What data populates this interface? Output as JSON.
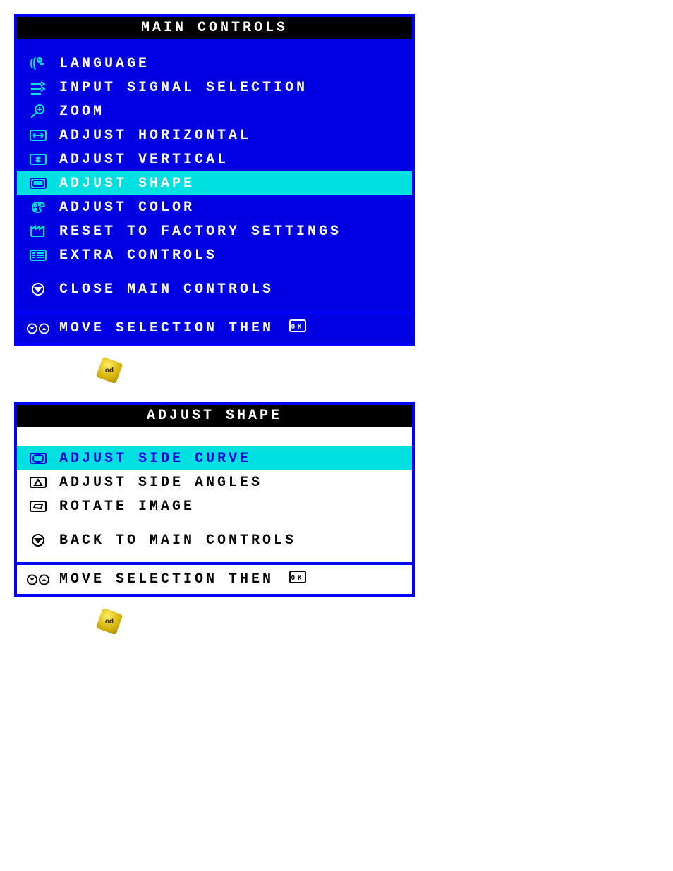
{
  "mainControls": {
    "title": "MAIN CONTROLS",
    "items": [
      {
        "label": "LANGUAGE",
        "selected": false
      },
      {
        "label": "INPUT SIGNAL SELECTION",
        "selected": false
      },
      {
        "label": "ZOOM",
        "selected": false
      },
      {
        "label": "ADJUST HORIZONTAL",
        "selected": false
      },
      {
        "label": "ADJUST VERTICAL",
        "selected": false
      },
      {
        "label": "ADJUST SHAPE",
        "selected": true
      },
      {
        "label": "ADJUST COLOR",
        "selected": false
      },
      {
        "label": "RESET TO FACTORY SETTINGS",
        "selected": false
      },
      {
        "label": "EXTRA CONTROLS",
        "selected": false
      }
    ],
    "closeLabel": "CLOSE MAIN CONTROLS",
    "footerText": "MOVE SELECTION THEN"
  },
  "adjustShape": {
    "title": "ADJUST SHAPE",
    "items": [
      {
        "label": "ADJUST SIDE CURVE",
        "selected": true
      },
      {
        "label": "ADJUST SIDE ANGLES",
        "selected": false
      },
      {
        "label": "ROTATE IMAGE",
        "selected": false
      }
    ],
    "backLabel": "BACK TO MAIN CONTROLS",
    "footerText": "MOVE SELECTION THEN"
  }
}
